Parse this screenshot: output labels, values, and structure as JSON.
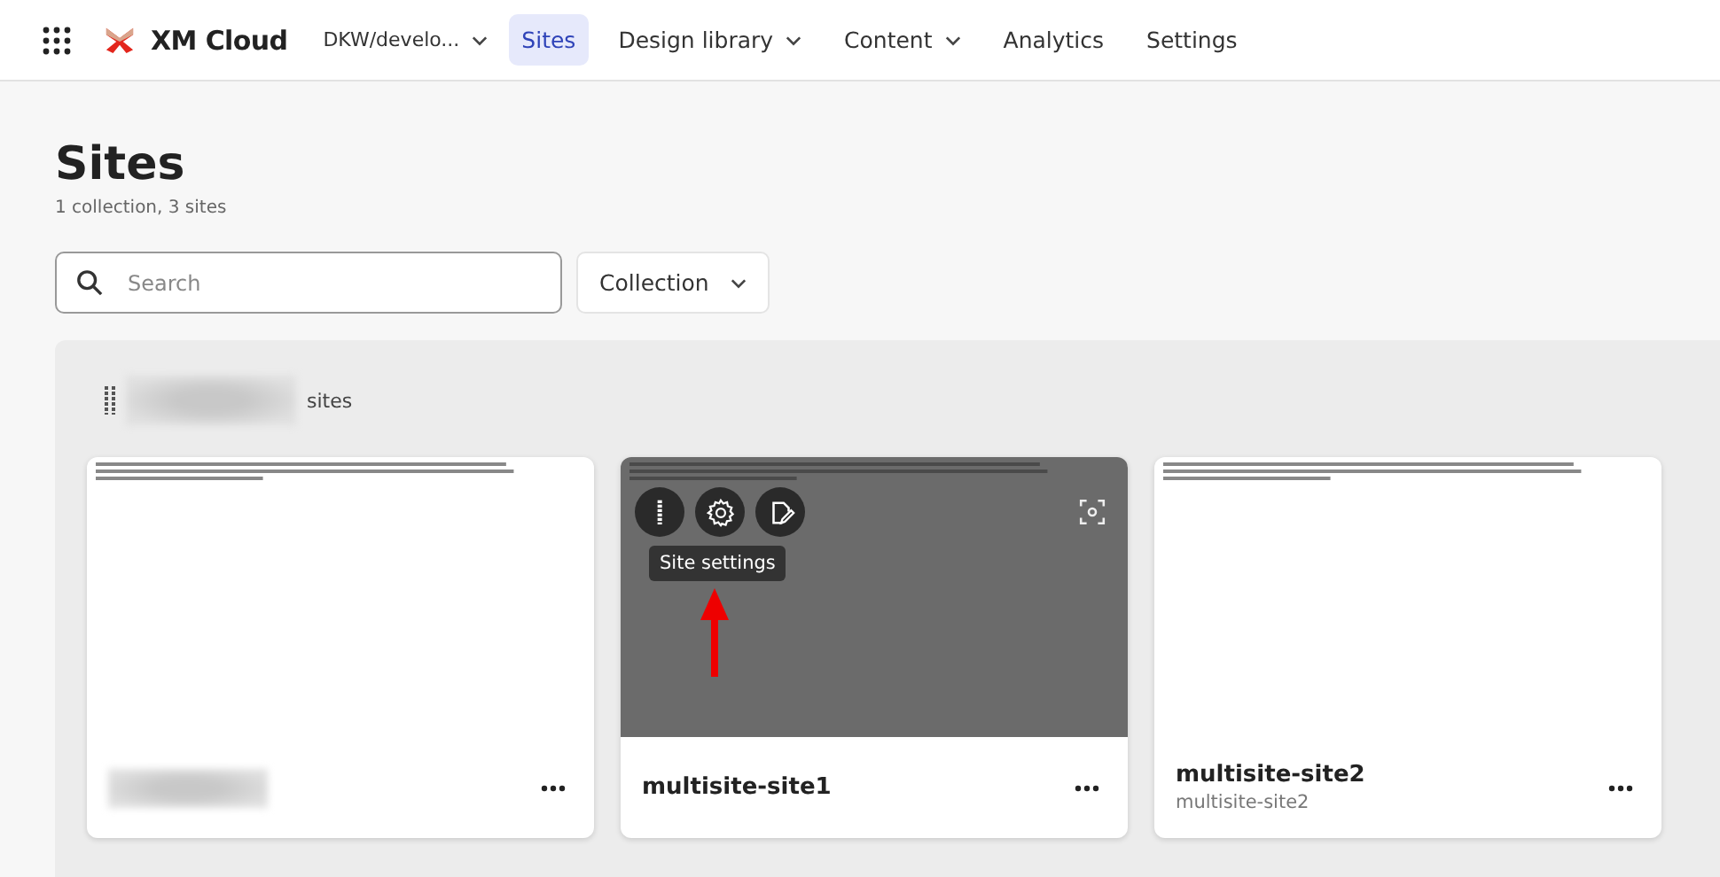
{
  "header": {
    "app_name": "XM Cloud",
    "environment": "DKW/develo...",
    "tabs": [
      {
        "label": "Sites",
        "selected": true,
        "has_menu": false
      },
      {
        "label": "Design library",
        "selected": false,
        "has_menu": true
      },
      {
        "label": "Content",
        "selected": false,
        "has_menu": true
      },
      {
        "label": "Analytics",
        "selected": false,
        "has_menu": false
      },
      {
        "label": "Settings",
        "selected": false,
        "has_menu": false
      }
    ]
  },
  "page": {
    "title": "Sites",
    "summary": "1 collection, 3 sites",
    "search": {
      "placeholder": "Search"
    },
    "filter": "Collection"
  },
  "collection": {
    "name_redacted": true,
    "label": "sites",
    "cards": [
      {
        "name_redacted": true,
        "hovered": false,
        "annotated": false
      },
      {
        "name": "multisite-site1",
        "hovered": true,
        "tooltip": "Site settings",
        "annotated": true
      },
      {
        "name": "multisite-site2",
        "subtitle": "multisite-site2",
        "hovered": false,
        "annotated": false
      }
    ]
  }
}
